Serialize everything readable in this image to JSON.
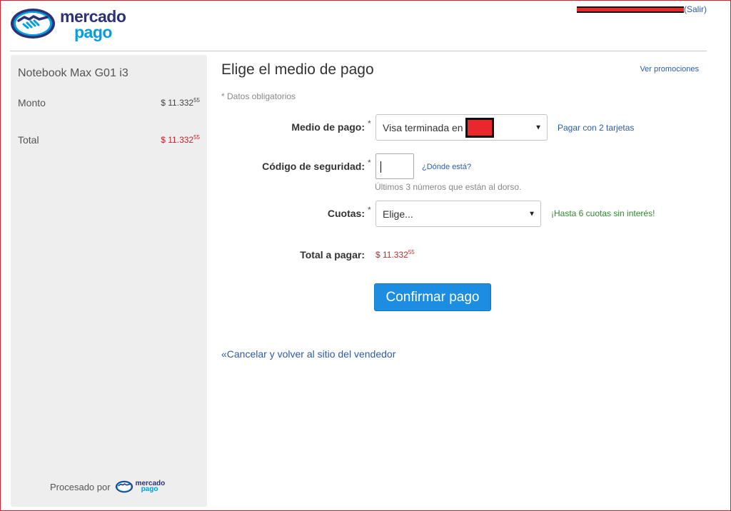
{
  "brand": {
    "line1": "mercado",
    "line2": "pago"
  },
  "header": {
    "logout_label": "(Salir)"
  },
  "sidebar": {
    "product": "Notebook Max G01 i3",
    "amount_label": "Monto",
    "amount_value": "$ 11.332",
    "amount_cents": "55",
    "total_label": "Total",
    "total_value": "$ 11.332",
    "total_cents": "55",
    "processed_label": "Procesado por"
  },
  "main": {
    "title": "Elige el medio de pago",
    "promo_link": "Ver promociones",
    "required_note": "* Datos obligatorios",
    "payment_method": {
      "label": "Medio de pago:",
      "asterisk": "*",
      "selected": "Visa terminada en",
      "alt_link": "Pagar con 2 tarjetas"
    },
    "security_code": {
      "label": "Código de seguridad:",
      "asterisk": "*",
      "help_link": "¿Dónde está?",
      "hint": "Últimos 3 números que están al dorso."
    },
    "installments": {
      "label": "Cuotas:",
      "asterisk": "*",
      "selected": "Elige...",
      "promo": "¡Hasta 6 cuotas sin interés!"
    },
    "total": {
      "label": "Total a pagar:",
      "value": "$ 11.332",
      "cents": "55"
    },
    "confirm_button": "Confirmar pago",
    "cancel_link": "«Cancelar y volver al sitio del vendedor"
  },
  "colors": {
    "brand_navy": "#2d3277",
    "brand_blue": "#009ee3",
    "button_blue": "#1c8de0",
    "price_red": "#c0272d",
    "success_green": "#2d8a2d",
    "link_blue": "#2d5ba8"
  }
}
